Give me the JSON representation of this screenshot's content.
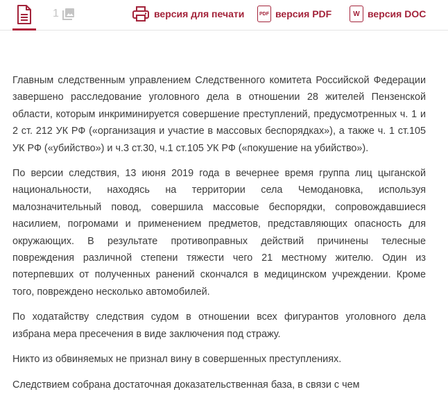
{
  "toolbar": {
    "images_count": "1",
    "print_label": "версия для печати",
    "pdf_label": "версия PDF",
    "pdf_badge": "PDF",
    "doc_label": "версия DOC",
    "doc_badge": "W",
    "accent_color": "#a3233a"
  },
  "article": {
    "paragraphs": [
      "Главным следственным управлением Следственного комитета  Российской Федерации завершено расследование уголовного дела в отношении 28 жителей Пензенской области, которым инкриминируется совершение преступлений, предусмотренных ч. 1 и 2 ст. 212 УК РФ («организация и участие в массовых беспорядках»), а также ч. 1 ст.105 УК РФ («убийство») и ч.3 ст.30, ч.1 ст.105 УК РФ («покушение на убийство»).",
      "По версии следствия, 13 июня 2019 года в вечернее время группа лиц цыганской национальности, находясь на территории села Чемодановка, используя малозначительный повод, совершила массовые беспорядки, сопровождавшиеся насилием, погромами и применением предметов, представляющих опасность для окружающих. В результате противоправных действий причинены телесные повреждения различной степени тяжести чего 21 местному жителю. Один из потерпевших от полученных ранений  скончался в медицинском учреждении. Кроме того, повреждено несколько автомобилей.",
      "По ходатайству следствия судом в отношении всех фигурантов уголовного дела избрана мера пресечения в виде заключения под стражу.",
      "Никто из обвиняемых не признал вину в совершенных преступлениях.",
      "Следствием собрана достаточная доказательственная база, в связи с чем"
    ]
  }
}
